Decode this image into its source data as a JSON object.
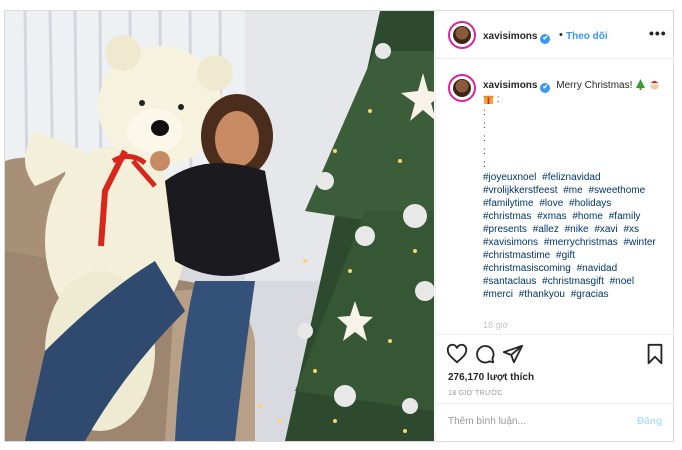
{
  "post": {
    "username": "xavisimons",
    "verified_badge": "✔",
    "follow_separator": "•",
    "follow_label": "Theo dõi",
    "more_label": "•••"
  },
  "caption": {
    "username": "xavisimons",
    "text": "Merry Christmas!",
    "dots": [
      ":",
      ":",
      ":",
      ":",
      ":"
    ],
    "hashtags": [
      "#joyeuxnoel",
      "#feliznavidad",
      "#vrolijkkerstfeest",
      "#me",
      "#sweethome",
      "#familytime",
      "#love",
      "#holidays",
      "#christmas",
      "#xmas",
      "#home",
      "#family",
      "#presents",
      "#allez",
      "#nike",
      "#xavi",
      "#xs",
      "#xavisimons",
      "#merrychristmas",
      "#winter",
      "#christmastime",
      "#gift",
      "#christmasiscoming",
      "#navidad",
      "#santaclaus",
      "#christmasgift",
      "#noel",
      "#merci",
      "#thankyou",
      "#gracias"
    ],
    "faded_time": "18 giờ"
  },
  "actions": {
    "like_icon": "heart-icon",
    "comment_icon": "comment-icon",
    "share_icon": "share-icon",
    "save_icon": "bookmark-icon",
    "likes_text": "276,170 lượt thích",
    "time_ago": "18 GIỜ TRƯỚC"
  },
  "comment": {
    "placeholder": "Thêm bình luận...",
    "post_label": "Đăng"
  },
  "colors": {
    "link_blue": "#3897f0",
    "hashtag": "#003569",
    "border": "#dbdbdb"
  }
}
